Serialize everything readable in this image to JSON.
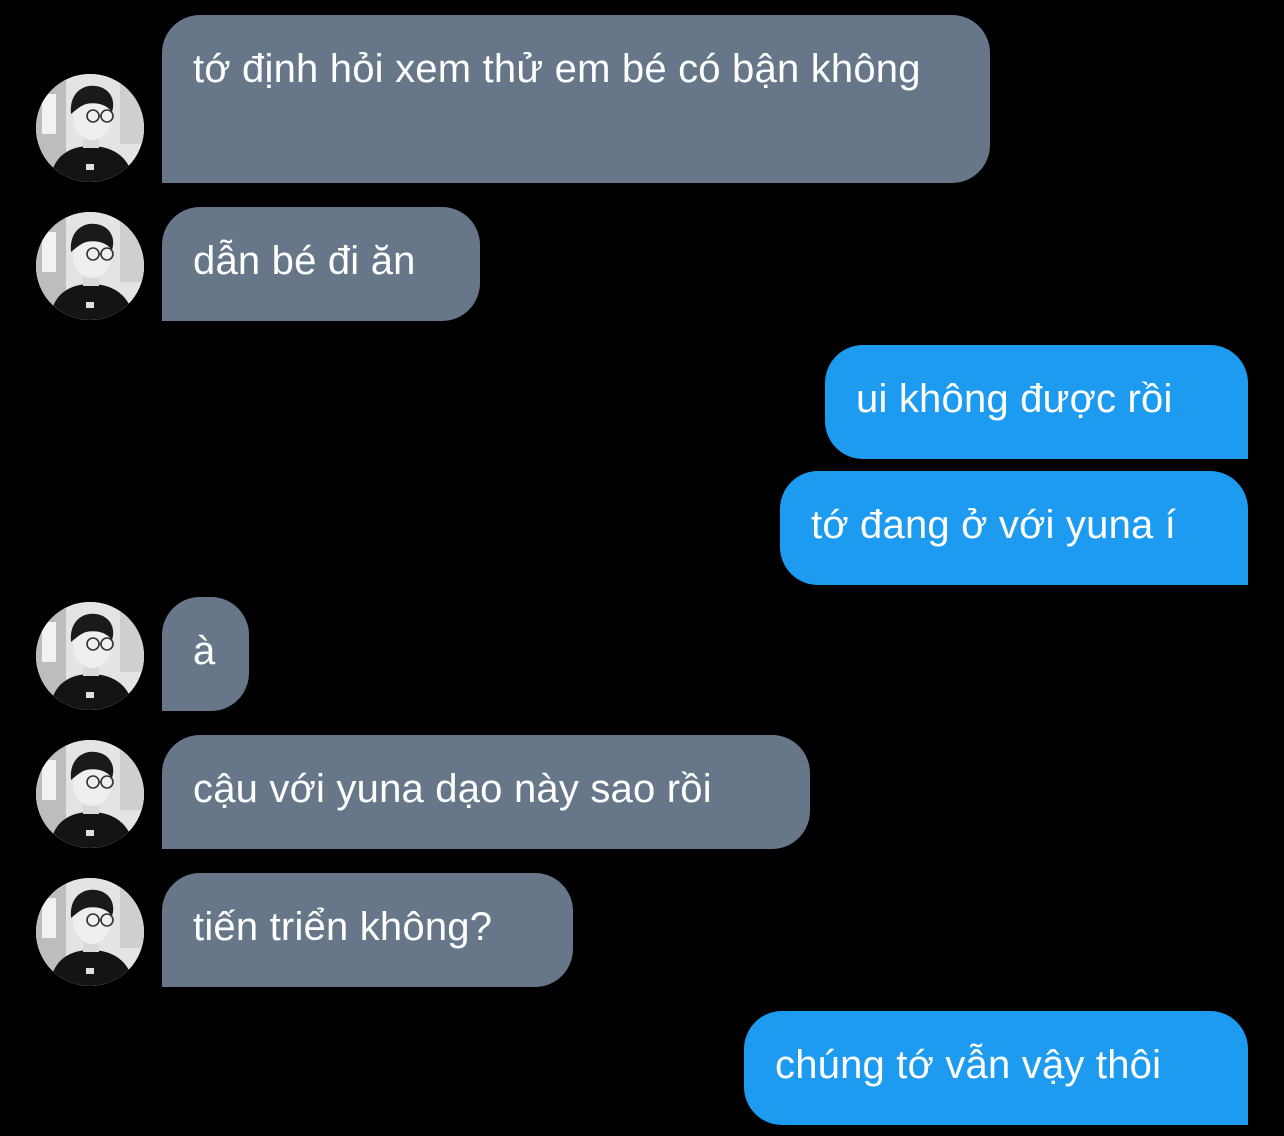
{
  "conversation": {
    "colors": {
      "background": "#000000",
      "incoming_bubble": "#677789",
      "outgoing_bubble": "#1d9bf0",
      "text": "#ffffff"
    },
    "messages": [
      {
        "id": "m1",
        "sender": "other",
        "avatar": "profile-photo",
        "text": "tớ định hỏi xem thử em bé có bận không"
      },
      {
        "id": "m2",
        "sender": "other",
        "avatar": "profile-photo",
        "text": "dẫn bé đi ăn"
      },
      {
        "id": "m3",
        "sender": "me",
        "text": "ui không được rồi"
      },
      {
        "id": "m4",
        "sender": "me",
        "text": "tớ đang ở với yuna í"
      },
      {
        "id": "m5",
        "sender": "other",
        "avatar": "profile-photo",
        "text": "à"
      },
      {
        "id": "m6",
        "sender": "other",
        "avatar": "profile-photo",
        "text": "cậu với yuna dạo này sao rồi"
      },
      {
        "id": "m7",
        "sender": "other",
        "avatar": "profile-photo",
        "text": "tiến triển không?"
      },
      {
        "id": "m8",
        "sender": "me",
        "text": "chúng tớ vẫn vậy thôi"
      }
    ]
  }
}
